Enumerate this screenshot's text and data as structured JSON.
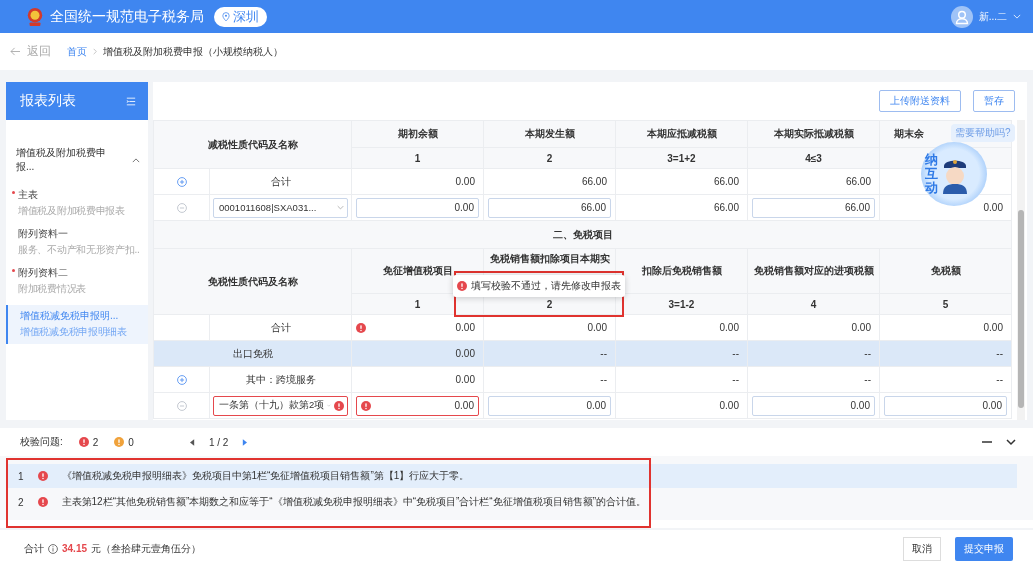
{
  "top_bar": {
    "title": "全国统一规范电子税务局",
    "city": "深圳",
    "user": "新...二"
  },
  "breadcrumb": {
    "back": "返回",
    "home": "首页",
    "current": "增值税及附加税费申报（小规模纳税人）"
  },
  "sidebar": {
    "title": "报表列表",
    "group": {
      "label": "增值税及附加税费申报...",
      "expanded": true
    },
    "items": [
      {
        "title": "主表",
        "subtitle": "增值税及附加税费申报表",
        "required": true,
        "selected": false
      },
      {
        "title": "附列资料一",
        "subtitle": "服务、不动产和无形资产扣..",
        "required": false,
        "selected": false
      },
      {
        "title": "附列资料二",
        "subtitle": "附加税费情况表",
        "required": true,
        "selected": false
      },
      {
        "title": "增值税减免税申报明...",
        "subtitle": "增值税减免税申报明细表",
        "required": false,
        "selected": true
      }
    ]
  },
  "toolbar": {
    "buttons": [
      "上传附送资料",
      "暂存"
    ]
  },
  "reduction_table": {
    "name_header": "减税性质代码及名称",
    "columns": [
      {
        "title": "期初余额",
        "index": "1"
      },
      {
        "title": "本期发生额",
        "index": "2"
      },
      {
        "title": "本期应抵减税额",
        "index": "3=1+2"
      },
      {
        "title": "本期实际抵减税额",
        "index": "4≤3"
      },
      {
        "title": "期末余"
      }
    ],
    "rows": [
      {
        "kind": "total",
        "expanded": false,
        "name": "合计",
        "cells": [
          {
            "value": "0.00"
          },
          {
            "value": "66.00"
          },
          {
            "value": "66.00"
          },
          {
            "value": "66.00"
          }
        ]
      },
      {
        "kind": "select",
        "expanded": true,
        "name": "0001011608|SXA031...",
        "error": false,
        "cells": [
          {
            "value": "0.00",
            "input": true
          },
          {
            "value": "66.00",
            "input": true
          },
          {
            "value": "66.00"
          },
          {
            "value": "66.00",
            "input": true
          },
          {
            "value": "0.00"
          }
        ]
      }
    ]
  },
  "exempt_table": {
    "section_title": "二、免税项目",
    "name_header": "免税性质代码及名称",
    "columns": [
      {
        "title": "免征增值税项目",
        "index": "1"
      },
      {
        "title": "免税销售额扣除项目本期实",
        "index": "2"
      },
      {
        "title": "扣除后免税销售额",
        "index": "3=1-2"
      },
      {
        "title": "免税销售额对应的进项税额",
        "index": "4"
      },
      {
        "title": "免税额",
        "index": "5"
      }
    ],
    "rows": [
      {
        "kind": "total",
        "name": "合计",
        "cells": [
          {
            "value": "0.00",
            "error": true
          },
          {
            "value": "0.00"
          },
          {
            "value": "0.00"
          },
          {
            "value": "0.00"
          },
          {
            "value": "0.00"
          }
        ]
      },
      {
        "kind": "category",
        "name": "出口免税",
        "cells": [
          {
            "value": "0.00"
          },
          {
            "value": "--"
          },
          {
            "value": "--"
          },
          {
            "value": "--"
          },
          {
            "value": "--"
          }
        ]
      },
      {
        "kind": "item",
        "expanded": false,
        "name": "其中：跨境服务",
        "cells": [
          {
            "value": "0.00"
          },
          {
            "value": "--"
          },
          {
            "value": "--"
          },
          {
            "value": "--"
          },
          {
            "value": "--"
          }
        ]
      },
      {
        "kind": "select",
        "expanded": true,
        "name": "一条第（十九）款第2项",
        "error": true,
        "cells": [
          {
            "value": "0.00",
            "input": true,
            "error": true
          },
          {
            "value": "0.00",
            "input": true
          },
          {
            "value": "0.00"
          },
          {
            "value": "0.00",
            "input": true
          },
          {
            "value": "0.00",
            "input": true
          }
        ]
      }
    ]
  },
  "toast": {
    "message": "填写校验不通过，请先修改申报表"
  },
  "helper": {
    "bubble": "需要帮助吗?",
    "badge": "纳互动"
  },
  "validation": {
    "label": "校验问题:",
    "errors": "2",
    "warnings": "0",
    "page": "1 / 2",
    "issues": [
      {
        "index": "1",
        "text": "《增值税减免税申报明细表》免税项目中第1栏“免征增值税项目销售额”第【1】行应大于零。",
        "selected": true
      },
      {
        "index": "2",
        "text": "主表第12栏“其他免税销售额”本期数之和应等于“《增值税减免税申报明细表》中“免税项目”合计栏“免征增值税项目销售额”的合计值。",
        "selected": false
      }
    ]
  },
  "footer": {
    "label": "合计",
    "amount": "34.15",
    "amount_words": "元（叁拾肆元壹角伍分）",
    "buttons": [
      "取消",
      "提交申报"
    ]
  }
}
